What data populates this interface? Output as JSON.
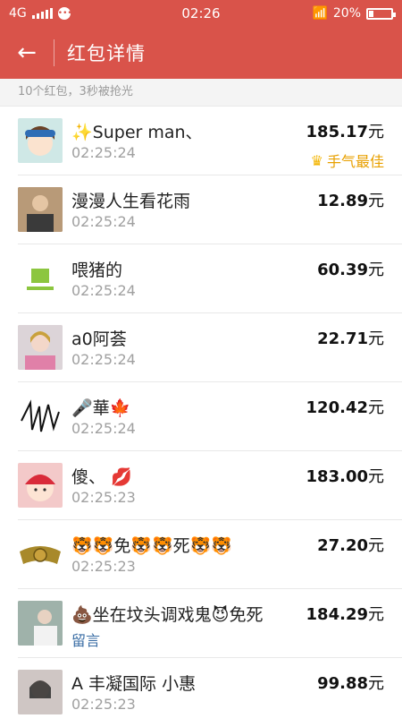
{
  "status": {
    "network": "4G",
    "time": "02:26",
    "battery": "20%"
  },
  "header": {
    "title": "红包详情"
  },
  "summary": "10个红包，3秒被抢光",
  "items": [
    {
      "name": "✨Super man、",
      "time": "02:25:24",
      "amount": "185.17",
      "unit": "元",
      "best": "手气最佳"
    },
    {
      "name": "漫漫人生看花雨",
      "time": "02:25:24",
      "amount": "12.89",
      "unit": "元"
    },
    {
      "name": "喂猪的",
      "time": "02:25:24",
      "amount": "60.39",
      "unit": "元"
    },
    {
      "name": "a0阿荟",
      "time": "02:25:24",
      "amount": "22.71",
      "unit": "元"
    },
    {
      "name": "🎤華🍁",
      "time": "02:25:24",
      "amount": "120.42",
      "unit": "元"
    },
    {
      "name": "傻、  💋",
      "time": "02:25:23",
      "amount": "183.00",
      "unit": "元"
    },
    {
      "name": "🐯🐯免🐯🐯死🐯🐯",
      "time": "02:25:23",
      "amount": "27.20",
      "unit": "元"
    },
    {
      "name": "💩坐在坟头调戏鬼😈免死",
      "comment": "留言",
      "amount": "184.29",
      "unit": "元"
    },
    {
      "name": "A   丰凝国际  小惠",
      "time": "02:25:23",
      "amount": "99.88",
      "unit": "元"
    }
  ],
  "avatar_colors": [
    "#cfe8e6",
    "#8a6d4f",
    "#ffffff",
    "#e9d0c6",
    "#ffffff",
    "#f3c9c9",
    "#ffffff",
    "#a7b6b0",
    "#d6d0cf"
  ]
}
